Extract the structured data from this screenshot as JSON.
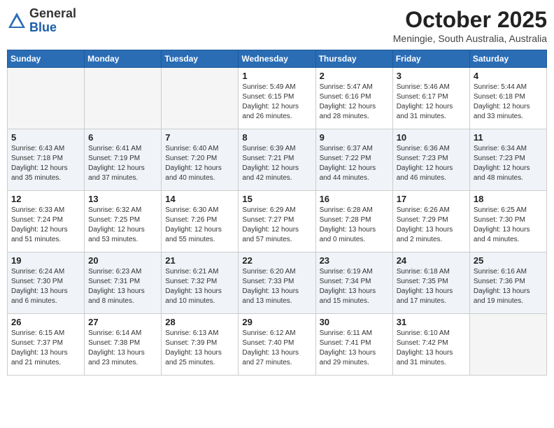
{
  "header": {
    "logo_line1": "General",
    "logo_line2": "Blue",
    "month": "October 2025",
    "location": "Meningie, South Australia, Australia"
  },
  "weekdays": [
    "Sunday",
    "Monday",
    "Tuesday",
    "Wednesday",
    "Thursday",
    "Friday",
    "Saturday"
  ],
  "weeks": [
    [
      {
        "day": "",
        "info": ""
      },
      {
        "day": "",
        "info": ""
      },
      {
        "day": "",
        "info": ""
      },
      {
        "day": "1",
        "info": "Sunrise: 5:49 AM\nSunset: 6:15 PM\nDaylight: 12 hours\nand 26 minutes."
      },
      {
        "day": "2",
        "info": "Sunrise: 5:47 AM\nSunset: 6:16 PM\nDaylight: 12 hours\nand 28 minutes."
      },
      {
        "day": "3",
        "info": "Sunrise: 5:46 AM\nSunset: 6:17 PM\nDaylight: 12 hours\nand 31 minutes."
      },
      {
        "day": "4",
        "info": "Sunrise: 5:44 AM\nSunset: 6:18 PM\nDaylight: 12 hours\nand 33 minutes."
      }
    ],
    [
      {
        "day": "5",
        "info": "Sunrise: 6:43 AM\nSunset: 7:18 PM\nDaylight: 12 hours\nand 35 minutes."
      },
      {
        "day": "6",
        "info": "Sunrise: 6:41 AM\nSunset: 7:19 PM\nDaylight: 12 hours\nand 37 minutes."
      },
      {
        "day": "7",
        "info": "Sunrise: 6:40 AM\nSunset: 7:20 PM\nDaylight: 12 hours\nand 40 minutes."
      },
      {
        "day": "8",
        "info": "Sunrise: 6:39 AM\nSunset: 7:21 PM\nDaylight: 12 hours\nand 42 minutes."
      },
      {
        "day": "9",
        "info": "Sunrise: 6:37 AM\nSunset: 7:22 PM\nDaylight: 12 hours\nand 44 minutes."
      },
      {
        "day": "10",
        "info": "Sunrise: 6:36 AM\nSunset: 7:23 PM\nDaylight: 12 hours\nand 46 minutes."
      },
      {
        "day": "11",
        "info": "Sunrise: 6:34 AM\nSunset: 7:23 PM\nDaylight: 12 hours\nand 48 minutes."
      }
    ],
    [
      {
        "day": "12",
        "info": "Sunrise: 6:33 AM\nSunset: 7:24 PM\nDaylight: 12 hours\nand 51 minutes."
      },
      {
        "day": "13",
        "info": "Sunrise: 6:32 AM\nSunset: 7:25 PM\nDaylight: 12 hours\nand 53 minutes."
      },
      {
        "day": "14",
        "info": "Sunrise: 6:30 AM\nSunset: 7:26 PM\nDaylight: 12 hours\nand 55 minutes."
      },
      {
        "day": "15",
        "info": "Sunrise: 6:29 AM\nSunset: 7:27 PM\nDaylight: 12 hours\nand 57 minutes."
      },
      {
        "day": "16",
        "info": "Sunrise: 6:28 AM\nSunset: 7:28 PM\nDaylight: 13 hours\nand 0 minutes."
      },
      {
        "day": "17",
        "info": "Sunrise: 6:26 AM\nSunset: 7:29 PM\nDaylight: 13 hours\nand 2 minutes."
      },
      {
        "day": "18",
        "info": "Sunrise: 6:25 AM\nSunset: 7:30 PM\nDaylight: 13 hours\nand 4 minutes."
      }
    ],
    [
      {
        "day": "19",
        "info": "Sunrise: 6:24 AM\nSunset: 7:30 PM\nDaylight: 13 hours\nand 6 minutes."
      },
      {
        "day": "20",
        "info": "Sunrise: 6:23 AM\nSunset: 7:31 PM\nDaylight: 13 hours\nand 8 minutes."
      },
      {
        "day": "21",
        "info": "Sunrise: 6:21 AM\nSunset: 7:32 PM\nDaylight: 13 hours\nand 10 minutes."
      },
      {
        "day": "22",
        "info": "Sunrise: 6:20 AM\nSunset: 7:33 PM\nDaylight: 13 hours\nand 13 minutes."
      },
      {
        "day": "23",
        "info": "Sunrise: 6:19 AM\nSunset: 7:34 PM\nDaylight: 13 hours\nand 15 minutes."
      },
      {
        "day": "24",
        "info": "Sunrise: 6:18 AM\nSunset: 7:35 PM\nDaylight: 13 hours\nand 17 minutes."
      },
      {
        "day": "25",
        "info": "Sunrise: 6:16 AM\nSunset: 7:36 PM\nDaylight: 13 hours\nand 19 minutes."
      }
    ],
    [
      {
        "day": "26",
        "info": "Sunrise: 6:15 AM\nSunset: 7:37 PM\nDaylight: 13 hours\nand 21 minutes."
      },
      {
        "day": "27",
        "info": "Sunrise: 6:14 AM\nSunset: 7:38 PM\nDaylight: 13 hours\nand 23 minutes."
      },
      {
        "day": "28",
        "info": "Sunrise: 6:13 AM\nSunset: 7:39 PM\nDaylight: 13 hours\nand 25 minutes."
      },
      {
        "day": "29",
        "info": "Sunrise: 6:12 AM\nSunset: 7:40 PM\nDaylight: 13 hours\nand 27 minutes."
      },
      {
        "day": "30",
        "info": "Sunrise: 6:11 AM\nSunset: 7:41 PM\nDaylight: 13 hours\nand 29 minutes."
      },
      {
        "day": "31",
        "info": "Sunrise: 6:10 AM\nSunset: 7:42 PM\nDaylight: 13 hours\nand 31 minutes."
      },
      {
        "day": "",
        "info": ""
      }
    ]
  ]
}
